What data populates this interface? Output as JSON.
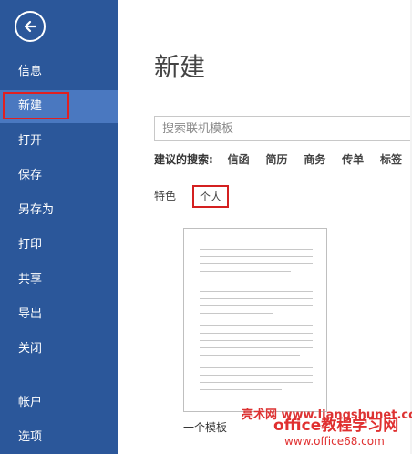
{
  "sidebar": {
    "items": [
      {
        "label": "信息"
      },
      {
        "label": "新建"
      },
      {
        "label": "打开"
      },
      {
        "label": "保存"
      },
      {
        "label": "另存为"
      },
      {
        "label": "打印"
      },
      {
        "label": "共享"
      },
      {
        "label": "导出"
      },
      {
        "label": "关闭"
      },
      {
        "label": "帐户"
      },
      {
        "label": "选项"
      }
    ],
    "active": "新建"
  },
  "main": {
    "title": "新建",
    "search": {
      "placeholder": "搜索联机模板"
    },
    "suggested": {
      "label": "建议的搜索:",
      "items": [
        "信函",
        "简历",
        "商务",
        "传单",
        "标签"
      ]
    },
    "tabs": [
      {
        "label": "特色"
      },
      {
        "label": "个人"
      }
    ],
    "template": {
      "label": "一个模板"
    }
  },
  "watermark": {
    "line1": "亮术网 www.liangshunet.com",
    "line2": "office教程学习网",
    "line3": "www.office68.com"
  },
  "colors": {
    "sidebar_bg": "#2b579a",
    "active_item_bg": "#4a78c0",
    "highlight_border": "#e02020"
  }
}
